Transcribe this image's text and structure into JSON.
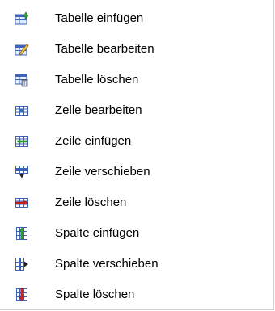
{
  "menu": {
    "items": [
      {
        "label": "Tabelle einfügen",
        "icon": "table-insert-icon"
      },
      {
        "label": "Tabelle bearbeiten",
        "icon": "table-edit-icon"
      },
      {
        "label": "Tabelle löschen",
        "icon": "table-delete-icon"
      },
      {
        "label": "Zelle bearbeiten",
        "icon": "cell-edit-icon"
      },
      {
        "label": "Zeile einfügen",
        "icon": "row-insert-icon"
      },
      {
        "label": "Zeile verschieben",
        "icon": "row-move-icon"
      },
      {
        "label": "Zeile löschen",
        "icon": "row-delete-icon"
      },
      {
        "label": "Spalte einfügen",
        "icon": "column-insert-icon"
      },
      {
        "label": "Spalte verschieben",
        "icon": "column-move-icon"
      },
      {
        "label": "Spalte löschen",
        "icon": "column-delete-icon"
      }
    ]
  },
  "colors": {
    "table_blue": "#3d63b8",
    "table_light": "#e6eefb",
    "insert_green": "#2ea02e",
    "delete_red": "#d42020",
    "dark": "#222222"
  }
}
